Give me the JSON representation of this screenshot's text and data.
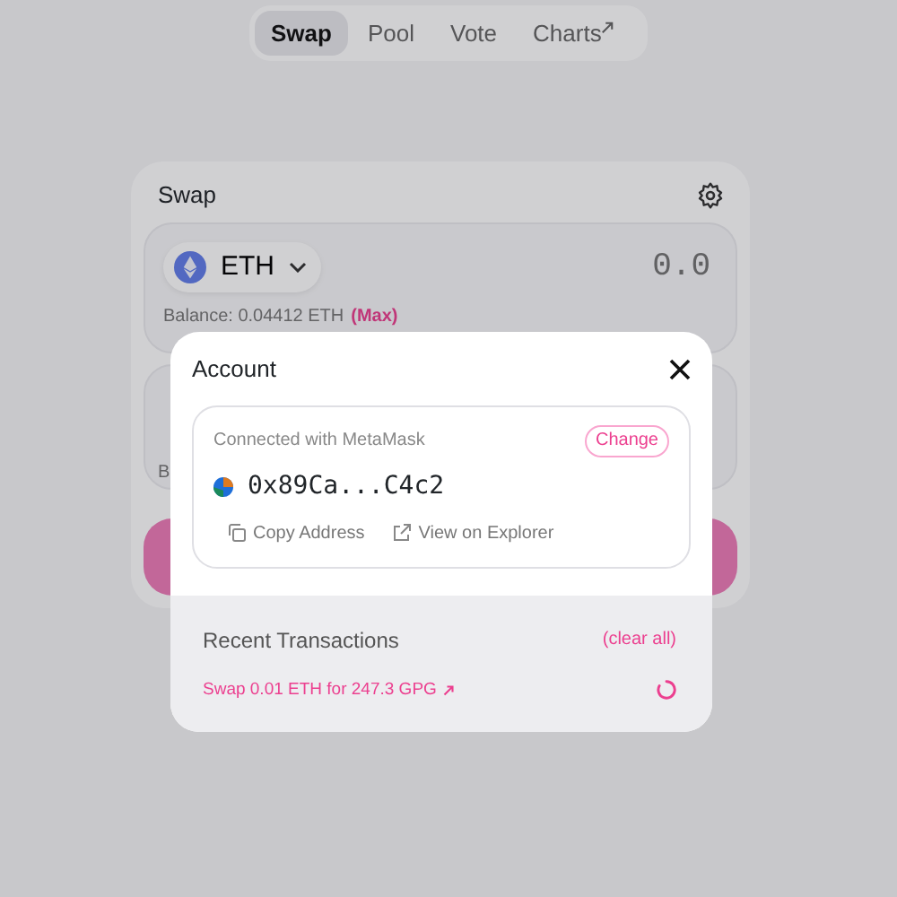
{
  "nav": {
    "tabs": [
      {
        "label": "Swap",
        "selected": true,
        "external": false
      },
      {
        "label": "Pool",
        "selected": false,
        "external": false
      },
      {
        "label": "Vote",
        "selected": false,
        "external": false
      },
      {
        "label": "Charts",
        "selected": false,
        "external": true
      }
    ]
  },
  "swap": {
    "title": "Swap",
    "from": {
      "token": "ETH",
      "amount_placeholder": "0.0",
      "balance": "Balance: 0.04412 ETH",
      "max": "(Max)"
    },
    "to": {
      "balance": "B"
    }
  },
  "account_modal": {
    "title": "Account",
    "wallet_label": "Connected with MetaMask",
    "change_button": "Change",
    "address": "0x89Ca...C4c2",
    "actions": [
      {
        "kind": "copy",
        "label": "Copy Address"
      },
      {
        "kind": "explorer",
        "label": "View on Explorer"
      }
    ],
    "recent": {
      "title": "Recent Transactions",
      "clear": "(clear all)",
      "transactions": [
        {
          "label": "Swap 0.01 ETH for 247.3 GPG",
          "pending": true
        }
      ]
    }
  }
}
